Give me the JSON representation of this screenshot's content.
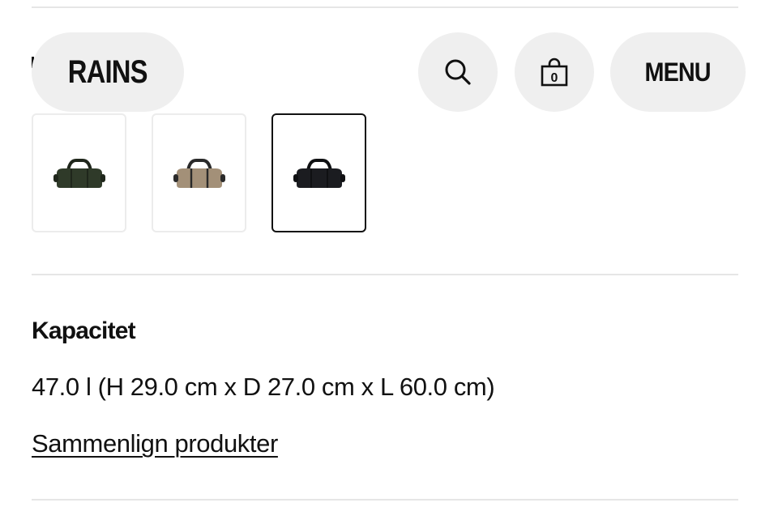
{
  "header": {
    "logo_text": "RAINS",
    "menu_label": "MENU",
    "cart_count": "0",
    "search_icon": "search-icon",
    "bag_icon": "shopping-bag-icon"
  },
  "thumbnails": [
    {
      "alt": "Green duffel bag",
      "color": "#2f3a29",
      "handle_color": "#1f261b",
      "selected": false
    },
    {
      "alt": "Taupe duffel bag",
      "color": "#a39078",
      "handle_color": "#2a2a2a",
      "selected": false
    },
    {
      "alt": "Black duffel bag",
      "color": "#1b1c20",
      "handle_color": "#0f1012",
      "selected": true
    }
  ],
  "specs": {
    "capacity_label": "Kapacitet",
    "capacity_value": "47.0 l (H 29.0 cm x D 27.0 cm x L 60.0 cm)"
  },
  "compare_link": "Sammenlign produkter"
}
